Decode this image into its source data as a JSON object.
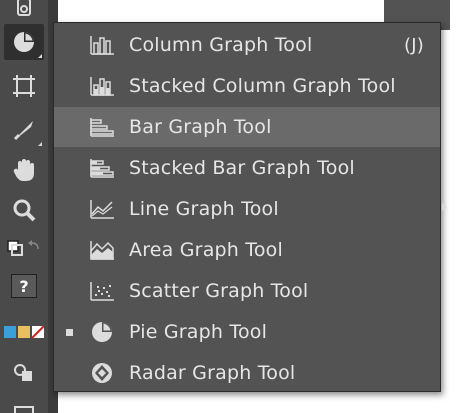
{
  "menu": {
    "items": [
      {
        "label": "Column Graph Tool",
        "shortcut": "(J)",
        "icon": "column-graph-icon",
        "highlighted": false,
        "checked": false
      },
      {
        "label": "Stacked Column Graph Tool",
        "shortcut": "",
        "icon": "stacked-column-graph-icon",
        "highlighted": false,
        "checked": false
      },
      {
        "label": "Bar Graph Tool",
        "shortcut": "",
        "icon": "bar-graph-icon",
        "highlighted": true,
        "checked": false
      },
      {
        "label": "Stacked Bar Graph Tool",
        "shortcut": "",
        "icon": "stacked-bar-graph-icon",
        "highlighted": false,
        "checked": false
      },
      {
        "label": "Line Graph Tool",
        "shortcut": "",
        "icon": "line-graph-icon",
        "highlighted": false,
        "checked": false
      },
      {
        "label": "Area Graph Tool",
        "shortcut": "",
        "icon": "area-graph-icon",
        "highlighted": false,
        "checked": false
      },
      {
        "label": "Scatter Graph Tool",
        "shortcut": "",
        "icon": "scatter-graph-icon",
        "highlighted": false,
        "checked": false
      },
      {
        "label": "Pie Graph Tool",
        "shortcut": "",
        "icon": "pie-graph-icon",
        "highlighted": false,
        "checked": true
      },
      {
        "label": "Radar Graph Tool",
        "shortcut": "",
        "icon": "radar-graph-icon",
        "highlighted": false,
        "checked": false
      }
    ]
  },
  "toolbar": {
    "help_glyph": "?",
    "tools": [
      "symbol-sprayer-icon",
      "pie-graph-icon",
      "artboard-icon",
      "slice-icon",
      "hand-icon",
      "zoom-icon",
      "fill-stroke-icon",
      "color-modes-icon",
      "screen-mode-icon"
    ]
  },
  "colors": {
    "panel_bg": "#535353",
    "highlight_bg": "#6a6a6a",
    "text": "#e6e6e6",
    "toolbar_bg": "#4a4a4a"
  }
}
